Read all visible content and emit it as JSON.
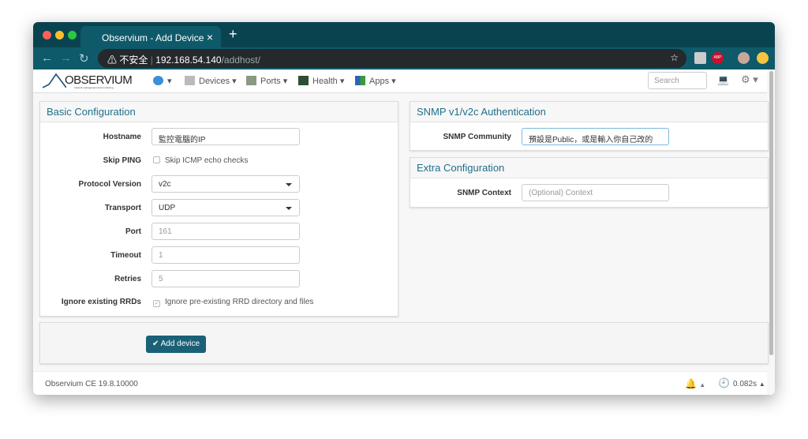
{
  "browser": {
    "tab_title": "Observium - Add Device",
    "security_label": "不安全",
    "url_host": "192.168.54.140",
    "url_path": "/addhost/",
    "ext_abp": "ABP"
  },
  "nav": {
    "logo": "OBSERVIUM",
    "logo_sub": "network management and monitoring",
    "items": [
      {
        "label": "Devices"
      },
      {
        "label": "Ports"
      },
      {
        "label": "Health"
      },
      {
        "label": "Apps"
      }
    ],
    "search_placeholder": "Search"
  },
  "basic": {
    "title": "Basic Configuration",
    "hostname_label": "Hostname",
    "hostname_value": "監控電腦的IP",
    "skip_ping_label": "Skip PING",
    "skip_ping_text": "Skip ICMP echo checks",
    "skip_ping_checked": false,
    "protocol_label": "Protocol Version",
    "protocol_value": "v2c",
    "transport_label": "Transport",
    "transport_value": "UDP",
    "port_label": "Port",
    "port_placeholder": "161",
    "timeout_label": "Timeout",
    "timeout_placeholder": "1",
    "retries_label": "Retries",
    "retries_placeholder": "5",
    "rrd_label": "Ignore existing RRDs",
    "rrd_text": "Ignore pre-existing RRD directory and files",
    "rrd_checked": true
  },
  "snmp": {
    "title": "SNMP v1/v2c Authentication",
    "community_label": "SNMP Community",
    "community_value": "預設是Public，或是輸入你自己改的"
  },
  "extra": {
    "title": "Extra Configuration",
    "context_label": "SNMP Context",
    "context_placeholder": "(Optional) Context"
  },
  "actions": {
    "add_label": "Add device"
  },
  "footer": {
    "version": "Observium CE 19.8.10000",
    "timing": "0.082s"
  },
  "colors": {
    "accent": "#1a6178",
    "chrome": "#0a4350"
  }
}
